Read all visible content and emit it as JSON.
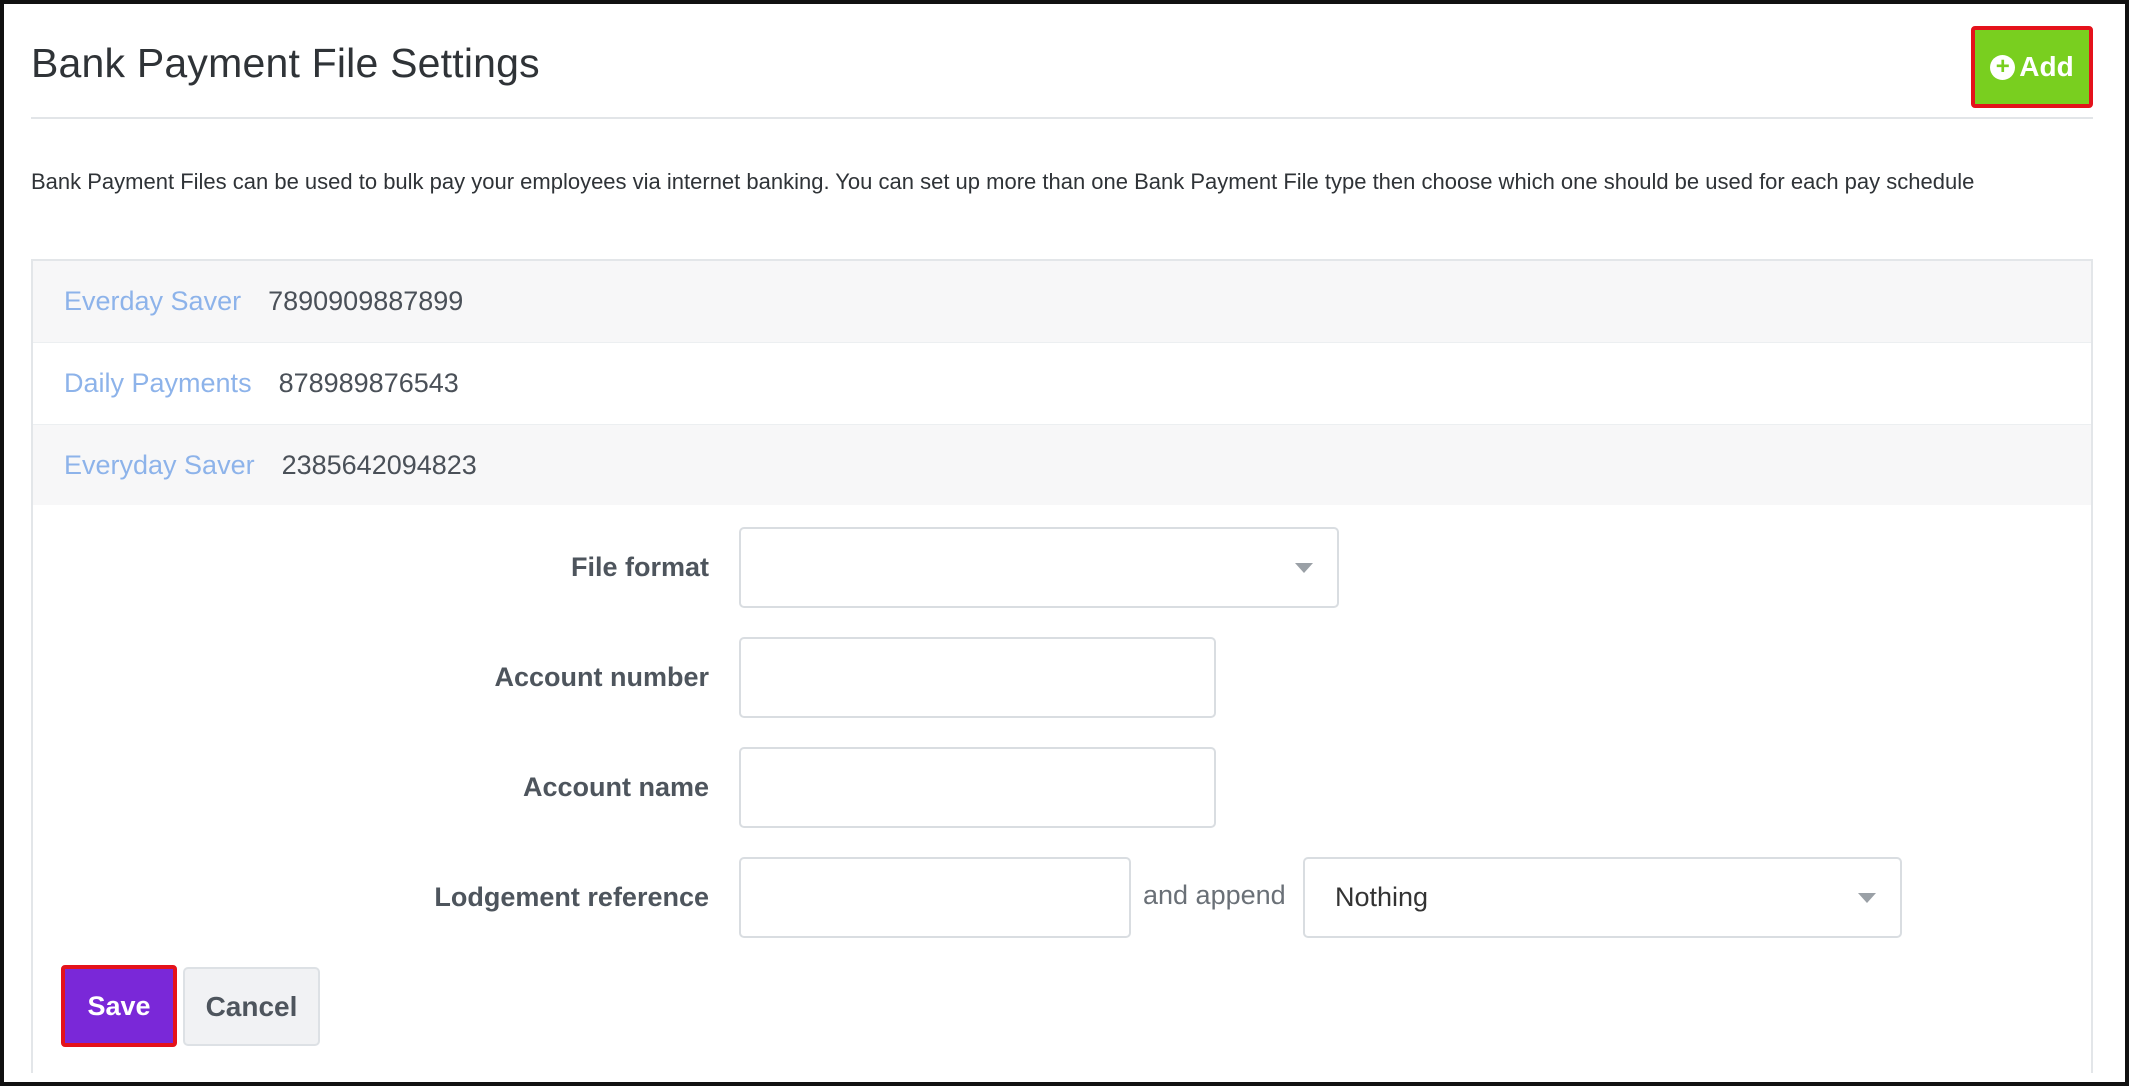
{
  "header": {
    "title": "Bank Payment File Settings",
    "add_label": "Add"
  },
  "description": "Bank Payment Files can be used to bulk pay your employees via internet banking. You can set up more than one Bank Payment File type then choose which one should be used for each pay schedule",
  "accounts": [
    {
      "name": "Everday Saver",
      "number": "7890909887899"
    },
    {
      "name": "Daily Payments",
      "number": "878989876543"
    },
    {
      "name": "Everyday Saver",
      "number": "2385642094823"
    }
  ],
  "form": {
    "file_format": {
      "label": "File format",
      "value": ""
    },
    "account_number": {
      "label": "Account number",
      "value": ""
    },
    "account_name": {
      "label": "Account name",
      "value": ""
    },
    "lodgement_reference": {
      "label": "Lodgement reference",
      "value": "",
      "append_text": "and append",
      "append_value": "Nothing"
    }
  },
  "buttons": {
    "save_label": "Save",
    "cancel_label": "Cancel"
  },
  "colors": {
    "add_button": "#79cf1f",
    "save_button": "#7a28d8",
    "highlight_border": "#e4121b",
    "account_link": "#8db3ea"
  }
}
